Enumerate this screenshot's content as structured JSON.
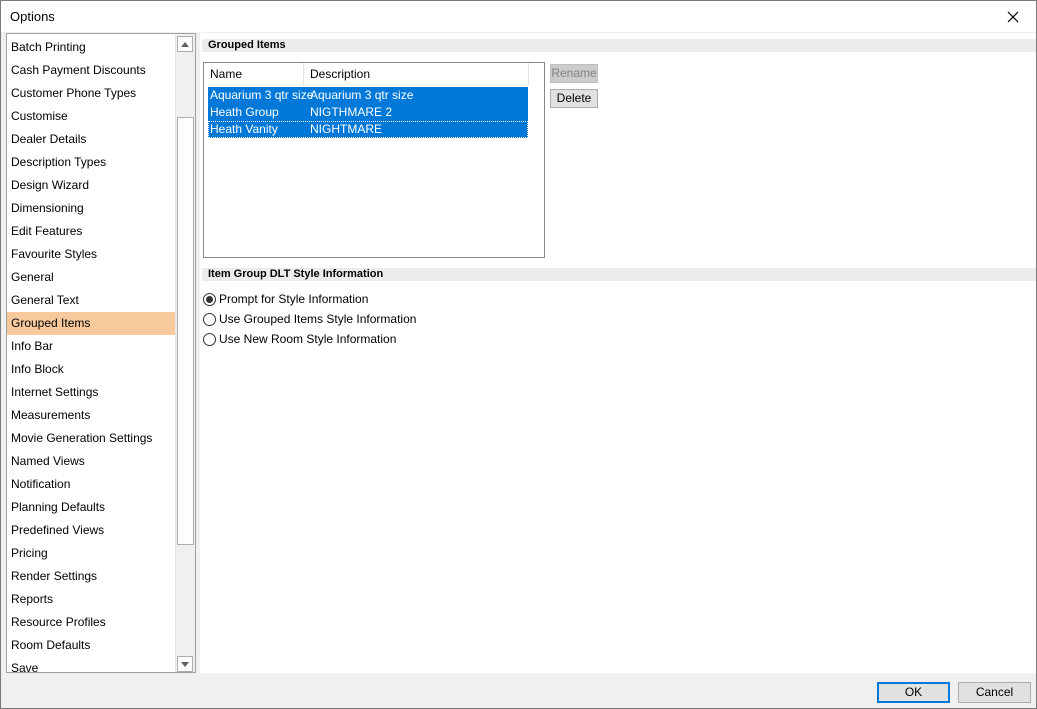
{
  "window": {
    "title": "Options"
  },
  "sidebar": {
    "items": [
      "Batch Printing",
      "Cash Payment Discounts",
      "Customer Phone Types",
      "Customise",
      "Dealer Details",
      "Description Types",
      "Design Wizard",
      "Dimensioning",
      "Edit Features",
      "Favourite Styles",
      "General",
      "General Text",
      "Grouped Items",
      "Info Bar",
      "Info Block",
      "Internet Settings",
      "Measurements",
      "Movie Generation Settings",
      "Named Views",
      "Notification",
      "Planning Defaults",
      "Predefined Views",
      "Pricing",
      "Render Settings",
      "Reports",
      "Resource Profiles",
      "Room Defaults",
      "Save"
    ],
    "selected": "Grouped Items"
  },
  "grouped_items": {
    "header": "Grouped Items",
    "columns": {
      "name": "Name",
      "description": "Description"
    },
    "rows": [
      {
        "name": "Aquarium 3 qtr size",
        "description": "Aquarium 3 qtr size"
      },
      {
        "name": "Heath Group",
        "description": "NIGTHMARE 2"
      },
      {
        "name": "Heath Vanity",
        "description": "NIGHTMARE"
      }
    ],
    "rename_label": "Rename",
    "delete_label": "Delete"
  },
  "style_info": {
    "header": "Item Group DLT Style Information",
    "options": [
      {
        "label": "Prompt for Style Information",
        "checked": true
      },
      {
        "label": "Use Grouped Items Style Information",
        "checked": false
      },
      {
        "label": "Use New Room Style Information",
        "checked": false
      }
    ]
  },
  "footer": {
    "ok_label": "OK",
    "cancel_label": "Cancel"
  },
  "icons": {
    "close": "close-icon",
    "scroll_up": "arrow-up-icon",
    "scroll_down": "arrow-down-icon"
  }
}
